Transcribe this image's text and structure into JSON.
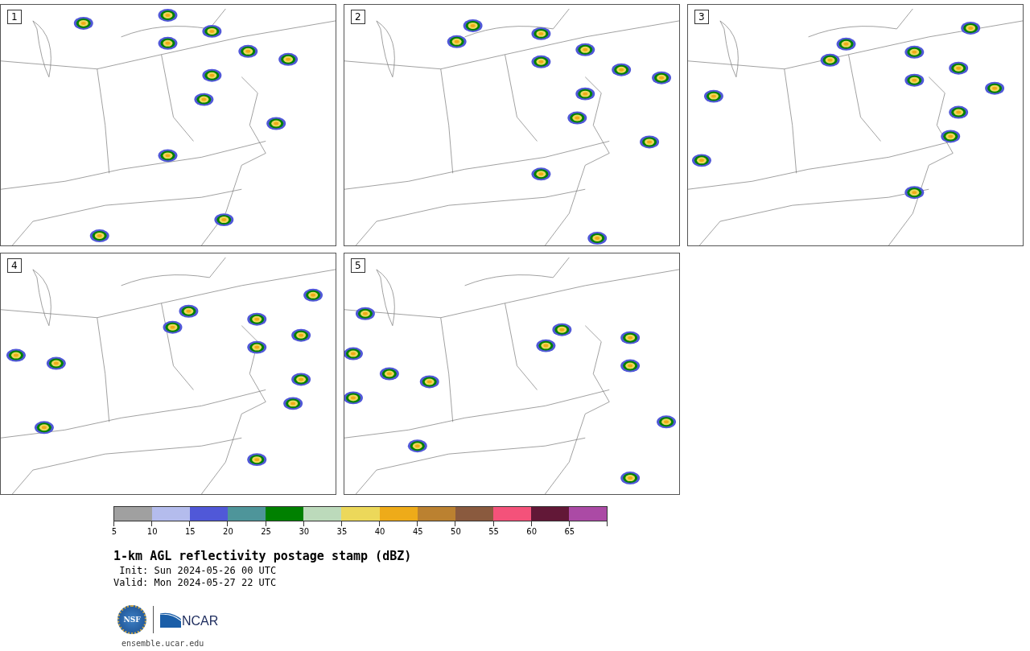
{
  "panels": [
    {
      "label": "1"
    },
    {
      "label": "2"
    },
    {
      "label": "3"
    },
    {
      "label": "4"
    },
    {
      "label": "5"
    }
  ],
  "colorbar": {
    "segments": [
      {
        "color": "#a0a0a0"
      },
      {
        "color": "#b4bced"
      },
      {
        "color": "#5058d8"
      },
      {
        "color": "#4e959a"
      },
      {
        "color": "#008000"
      },
      {
        "color": "#bcdabb"
      },
      {
        "color": "#ecd85a"
      },
      {
        "color": "#eeab19"
      },
      {
        "color": "#bb8130"
      },
      {
        "color": "#8a5a3e"
      },
      {
        "color": "#f4527a"
      },
      {
        "color": "#621837"
      },
      {
        "color": "#ab4aa5"
      }
    ],
    "ticks": [
      "5",
      "10",
      "15",
      "20",
      "25",
      "30",
      "35",
      "40",
      "45",
      "50",
      "55",
      "60",
      "65"
    ]
  },
  "title": "1-km AGL reflectivity postage stamp (dBZ)",
  "init": " Init: Sun 2024-05-26 00 UTC",
  "valid": "Valid: Mon 2024-05-27 22 UTC",
  "logo": {
    "seal_text": "NSF",
    "wordmark": "NCAR"
  },
  "url": "ensemble.ucar.edu"
}
